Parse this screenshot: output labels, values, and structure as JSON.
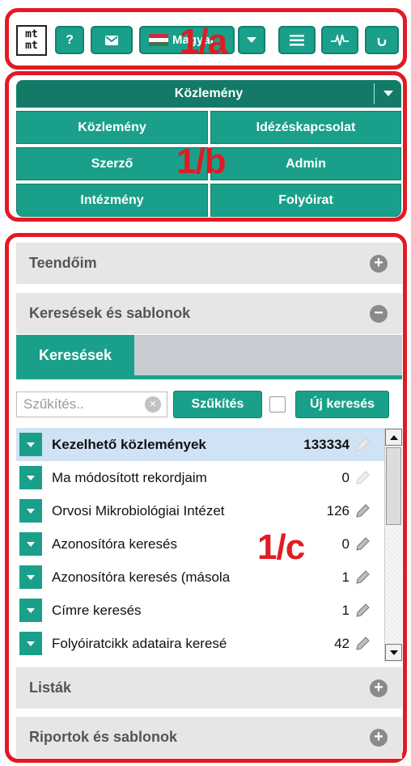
{
  "toolbar": {
    "logo_line1": "mt",
    "logo_line2": "mt",
    "help_label": "?",
    "mail_icon": "envelope-icon",
    "language_label": "Magyar",
    "language_flag_colors": [
      "#cd2a3e",
      "#ffffff",
      "#436f4d"
    ],
    "menu_icon": "hamburger-icon",
    "activity_icon": "pulse-icon",
    "refresh_icon": "refresh-icon"
  },
  "annotations": {
    "a": "1/a",
    "b": "1/b",
    "c": "1/c"
  },
  "record_type": {
    "selected": "Közlemény",
    "buttons": [
      "Közlemény",
      "Idézéskapcsolat",
      "Szerző",
      "Admin",
      "Intézmény",
      "Folyóirat"
    ]
  },
  "panels": {
    "todos": "Teendőim",
    "searches_templates": "Keresések és sablonok",
    "lists": "Listák",
    "reports": "Riportok és sablonok"
  },
  "searches": {
    "tab": "Keresések",
    "filter_placeholder": "Szűkítés..",
    "filter_button": "Szűkítés",
    "new_search_button": "Új keresés",
    "items": [
      {
        "name": "Kezelhető közlemények",
        "count": "133334",
        "selected": true
      },
      {
        "name": "Ma módosított rekordjaim",
        "count": "0"
      },
      {
        "name": "Orvosi Mikrobiológiai Intézet",
        "count": "126"
      },
      {
        "name": "Azonosítóra keresés",
        "count": "0"
      },
      {
        "name": "Azonosítóra keresés (másola",
        "count": "1"
      },
      {
        "name": "Címre keresés",
        "count": "1"
      },
      {
        "name": "Folyóiratcikk adataira keresé",
        "count": "42"
      }
    ]
  },
  "colors": {
    "accent": "#1aa08a",
    "accent_dark": "#137a68",
    "annotation": "#e01b24",
    "selected_row": "#cfe3f5",
    "panel_bg": "#e6e6e6"
  }
}
